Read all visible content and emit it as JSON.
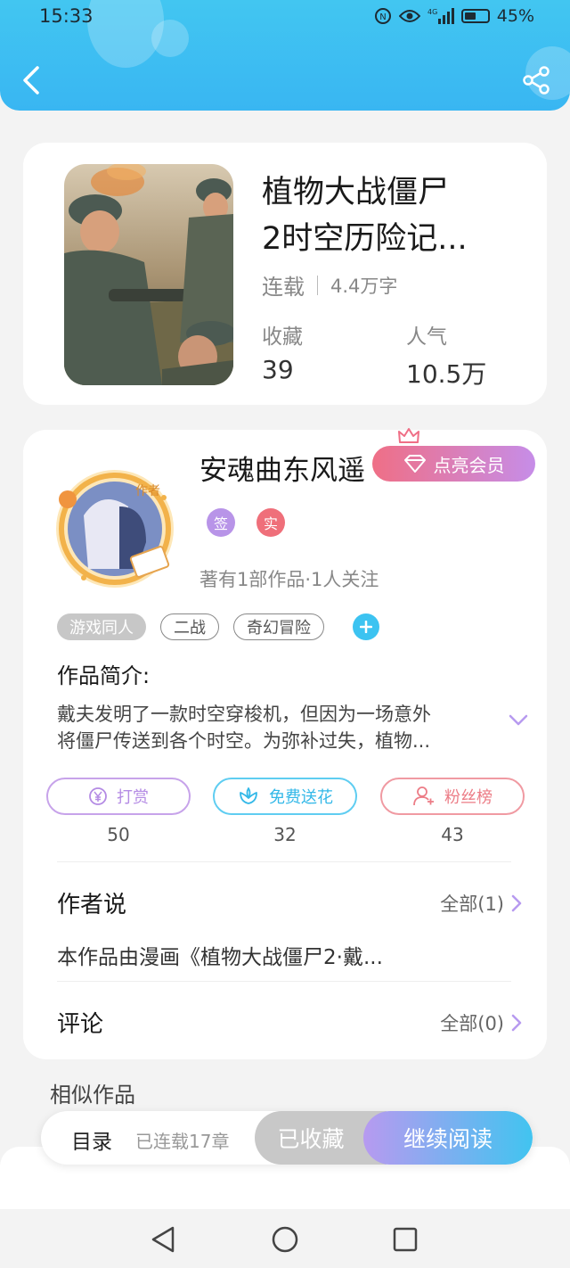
{
  "status_bar": {
    "time": "15:33",
    "battery": "45%",
    "network": "4G"
  },
  "colors": {
    "header": "#3fbff2",
    "accent_blue": "#41c4f0",
    "accent_purple": "#b79af0",
    "vip_pink": "#ef6f86"
  },
  "book": {
    "title_line1": "植物大战僵尸",
    "title_line2": "2时空历险记...",
    "status": "连载",
    "word_count": "4.4万字",
    "favorites_label": "收藏",
    "favorites_value": "39",
    "popularity_label": "人气",
    "popularity_value": "10.5万"
  },
  "author": {
    "name": "安魂曲东风遥",
    "vip_button": "点亮会员",
    "badge_sign": "签",
    "badge_real": "实",
    "avatar_tag": "作者",
    "stats": "著有1部作品·1人关注"
  },
  "tags": [
    "游戏同人",
    "二战",
    "奇幻冒险"
  ],
  "intro": {
    "title": "作品简介:",
    "line1": "戴夫发明了一款时空穿梭机，但因为一场意外",
    "line2": "将僵尸传送到各个时空。为弥补过失，植物..."
  },
  "actions": {
    "tip_label": "打赏",
    "tip_count": "50",
    "flower_label": "免费送花",
    "flower_count": "32",
    "fans_label": "粉丝榜",
    "fans_count": "43"
  },
  "author_says": {
    "title": "作者说",
    "more": "全部(1)",
    "text": "本作品由漫画《植物大战僵尸2·戴..."
  },
  "comments": {
    "title": "评论",
    "more": "全部(0)"
  },
  "similar": {
    "title": "相似作品"
  },
  "bottom_bar": {
    "toc": "目录",
    "chapters": "已连载17章",
    "favorited": "已收藏",
    "continue": "继续阅读"
  }
}
